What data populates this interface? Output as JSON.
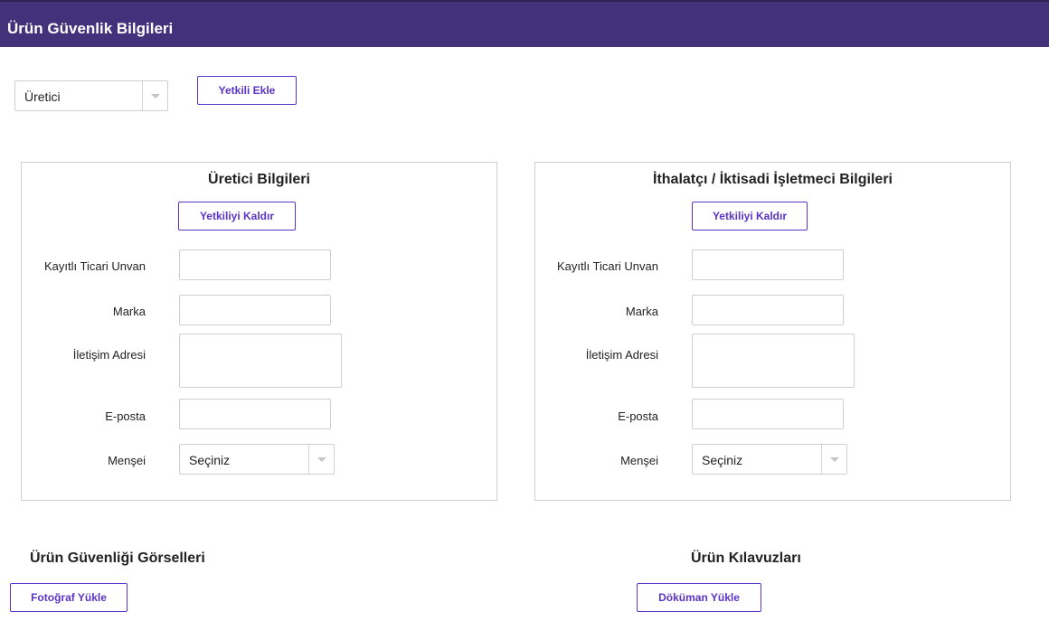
{
  "header": {
    "title": "Ürün Güvenlik Bilgileri"
  },
  "top": {
    "type_select_value": "Üretici",
    "add_authorized_label": "Yetkili Ekle"
  },
  "panels": [
    {
      "title": "Üretici Bilgileri",
      "remove_label": "Yetkiliyi Kaldır",
      "fields": {
        "trade_name_label": "Kayıtlı Ticari Unvan",
        "brand_label": "Marka",
        "address_label": "İletişim Adresi",
        "email_label": "E-posta",
        "origin_label": "Menşei",
        "origin_value": "Seçiniz"
      }
    },
    {
      "title": "İthalatçı / İktisadi İşletmeci Bilgileri",
      "remove_label": "Yetkiliyi Kaldır",
      "fields": {
        "trade_name_label": "Kayıtlı Ticari Unvan",
        "brand_label": "Marka",
        "address_label": "İletişim Adresi",
        "email_label": "E-posta",
        "origin_label": "Menşei",
        "origin_value": "Seçiniz"
      }
    }
  ],
  "images_section": {
    "title": "Ürün Güvenliği Görselleri",
    "upload_label": "Fotoğraf Yükle"
  },
  "manuals_section": {
    "title": "Ürün Kılavuzları",
    "upload_label": "Döküman Yükle"
  },
  "icons": {
    "dropdown": "chevron-down-icon"
  },
  "colors": {
    "header_bg": "#43317b",
    "accent": "#5a34c9"
  }
}
